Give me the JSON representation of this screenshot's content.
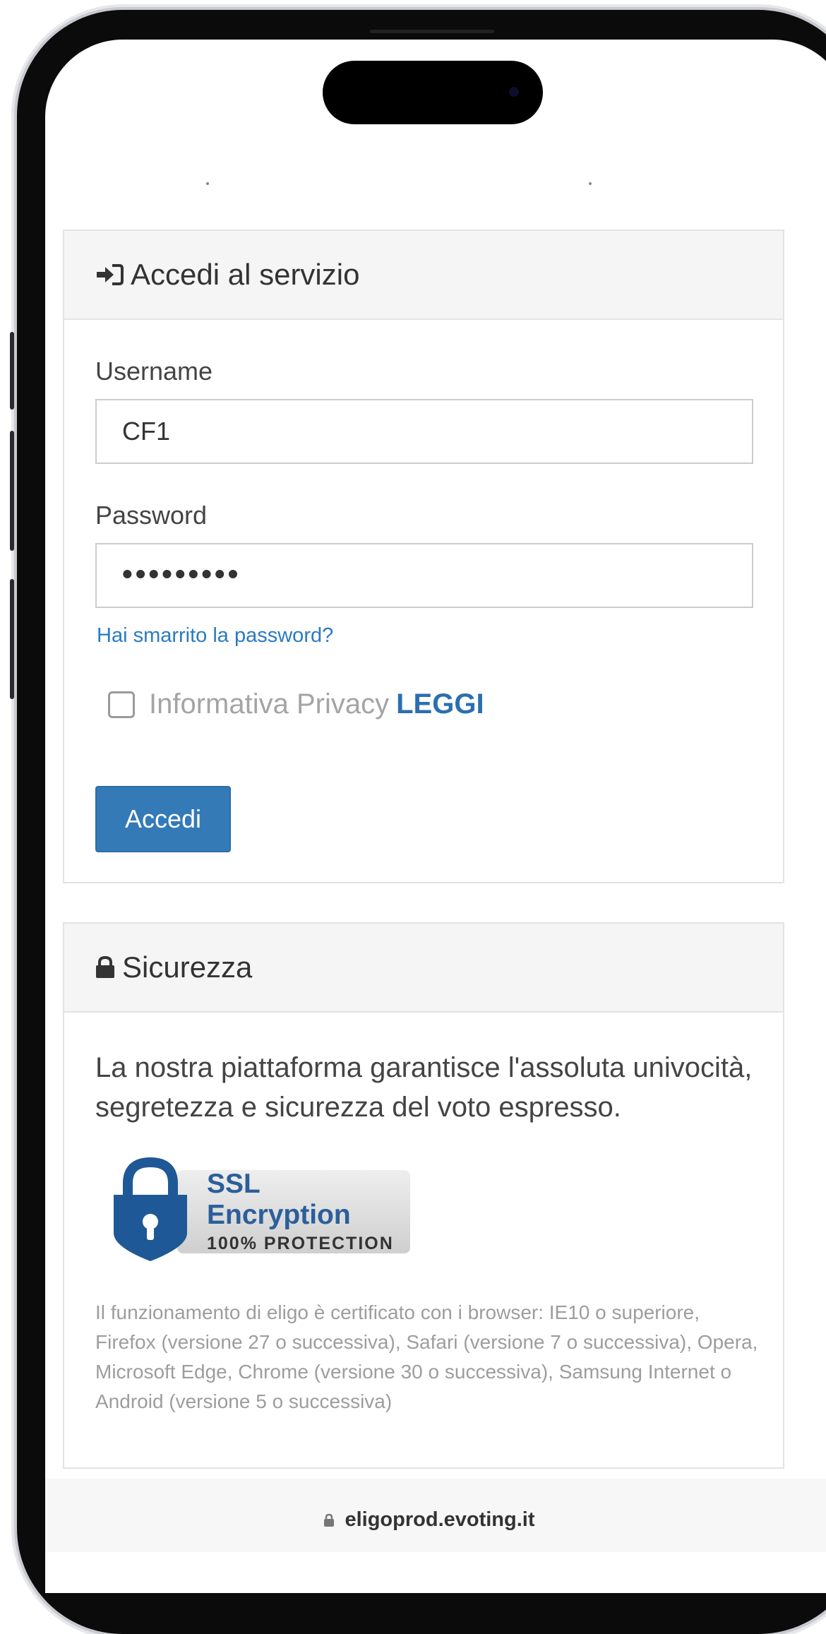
{
  "login_panel": {
    "title": "Accedi al servizio",
    "icon": "sign-in-icon",
    "username_label": "Username",
    "username_value": "CF1",
    "password_label": "Password",
    "password_masked": "•••••••••",
    "forgot_link": "Hai smarrito la password?",
    "privacy_label": "Informativa Privacy",
    "privacy_link": "LEGGI",
    "privacy_checked": false,
    "submit_label": "Accedi"
  },
  "security_panel": {
    "title": "Sicurezza",
    "icon": "lock-icon",
    "description": "La nostra piattaforma garantisce l'assoluta univocità, segretezza e sicurezza del voto espresso.",
    "badge_title": "SSL Encryption",
    "badge_subtitle": "100% PROTECTION",
    "browser_note": "Il funzionamento di eligo è certificato con i browser: IE10 o superiore, Firefox (versione 27 o successiva), Safari (versione 7 o successiva), Opera, Microsoft Edge, Chrome (versione 30 o successiva), Samsung Internet o Android (versione 5 o successiva)"
  },
  "browser_bar": {
    "url": "eligoprod.evoting.it",
    "icon": "lock-icon"
  },
  "colors": {
    "primary": "#337ab7",
    "link": "#2a7bc1",
    "panel_heading_bg": "#f5f5f5",
    "badge_blue": "#2b5f9b"
  }
}
